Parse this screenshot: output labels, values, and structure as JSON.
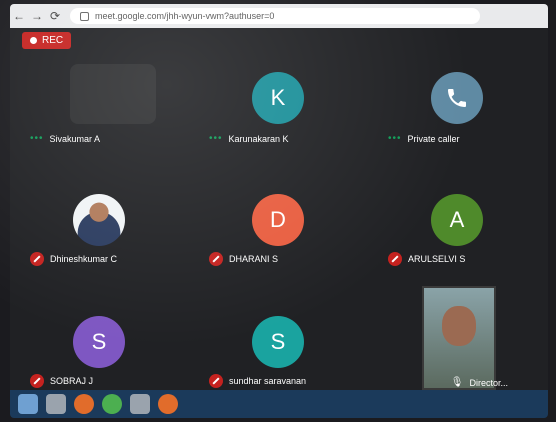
{
  "browser": {
    "url": "meet.google.com/jhh-wyun-vwm?authuser=0"
  },
  "meeting": {
    "rec_label": "REC"
  },
  "participants": [
    {
      "name": "Sivakumar A",
      "type": "video",
      "status": "speaking"
    },
    {
      "name": "Karunakaran K",
      "type": "avatar",
      "initial": "K",
      "color": "#1a8f99",
      "status": "speaking"
    },
    {
      "name": "Private caller",
      "type": "phone",
      "status": "speaking"
    },
    {
      "name": "Dhineshkumar C",
      "type": "photo",
      "status": "muted"
    },
    {
      "name": "DHARANI S",
      "type": "avatar",
      "initial": "D",
      "color": "#e85d3f",
      "status": "muted"
    },
    {
      "name": "ARULSELVI S",
      "type": "avatar",
      "initial": "A",
      "color": "#4f8a2b",
      "status": "muted"
    },
    {
      "name": "SOBRAJ J",
      "type": "avatar",
      "initial": "S",
      "color": "#7e57c2",
      "status": "muted"
    },
    {
      "name": "sundhar saravanan",
      "type": "avatar",
      "initial": "S",
      "color": "#1aa39f",
      "status": "muted"
    },
    {
      "name": "Director...",
      "type": "self",
      "status": "mic-on"
    }
  ],
  "colors": {
    "mute_red": "#c5221f",
    "speaking_green": "#0f9d58"
  }
}
